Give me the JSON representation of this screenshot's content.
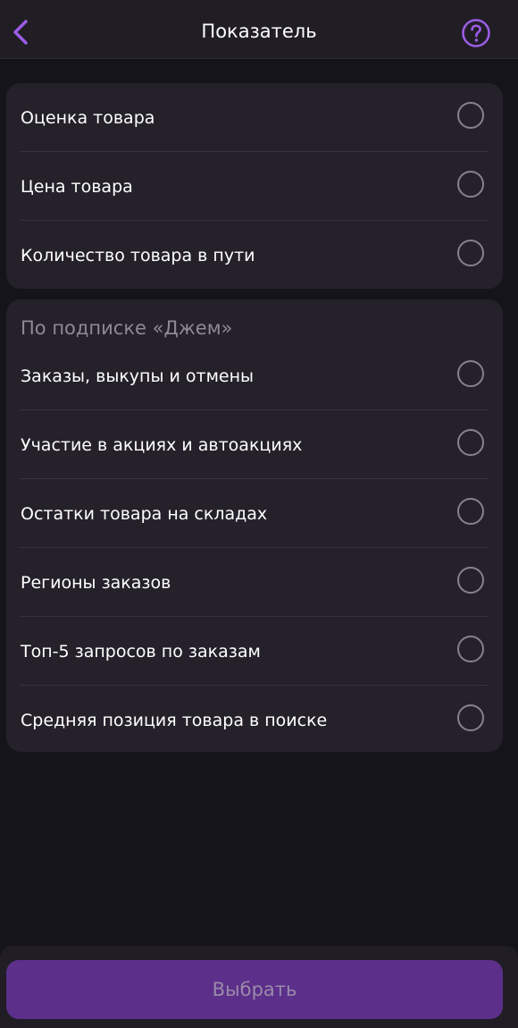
{
  "header": {
    "title": "Показатель",
    "back_icon": "chevron-left-icon",
    "help_icon": "help-circle-icon"
  },
  "basic_group": {
    "items": [
      {
        "label": "Оценка товара",
        "selected": false
      },
      {
        "label": "Цена товара",
        "selected": false
      },
      {
        "label": "Количество товара в пути",
        "selected": false
      }
    ]
  },
  "subscription_group": {
    "title": "По подписке «Джем»",
    "items": [
      {
        "label": "Заказы, выкупы и отмены",
        "selected": false
      },
      {
        "label": "Участие в акциях и автоакциях",
        "selected": false
      },
      {
        "label": "Остатки товара на складах",
        "selected": false
      },
      {
        "label": "Регионы заказов",
        "selected": false
      },
      {
        "label": "Топ-5 запросов по заказам",
        "selected": false
      },
      {
        "label": "Средняя позиция товара в поиске",
        "selected": false
      }
    ]
  },
  "footer": {
    "select_label": "Выбрать"
  },
  "colors": {
    "accent": "#9b5de5",
    "background": "#16141b",
    "card": "#24212a",
    "button": "#5c2f8a"
  }
}
